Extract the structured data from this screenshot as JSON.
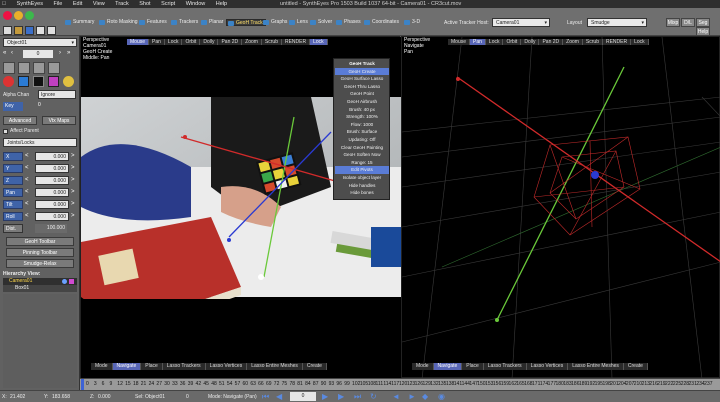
{
  "menubar": {
    "app": "SynthEyes",
    "items": [
      "File",
      "Edit",
      "View",
      "Track",
      "Shot",
      "Script",
      "Window",
      "Help"
    ],
    "title": "untitled - SynthEyes Pro 1503 Build 1037 64-bit - Camera01 - CR3cut.mov"
  },
  "toolbar": {
    "summary": "Summary",
    "roto": "Roto Masking",
    "features": "Features",
    "trackers": "Trackers",
    "planar": "Planar",
    "geotrack": "GeoH Track",
    "graphs": "Graphs",
    "lens": "Lens",
    "solver": "Solver",
    "phases": "Phases",
    "coordinates": "Coordinates",
    "threed": "3-D",
    "active_host_label": "Active Tracker Host:",
    "active_host_value": "Camera01",
    "layout_label": "Layout",
    "layout_value": "Smudge",
    "mixed_buttons": [
      "Mixp",
      "D/L",
      "Seg",
      "Help"
    ]
  },
  "leftpanel": {
    "object_select": "Object01",
    "frame_value": "0",
    "alpha_label": "Alpha Chan",
    "alpha_value": "Ignore",
    "key_label": "Key",
    "key_value": "0",
    "advanced": "Advanced",
    "vtx_maps": "Vtx Maps",
    "affect_parent": "Affect Parent",
    "joints_select": "Joints/Locks",
    "axes": [
      {
        "key": "X",
        "val": "0.000"
      },
      {
        "key": "Y",
        "val": "0.000"
      },
      {
        "key": "Z",
        "val": "0.000"
      },
      {
        "key": "Pan",
        "val": "0.000"
      },
      {
        "key": "Tilt",
        "val": "0.000"
      },
      {
        "key": "Roll",
        "val": "0.000"
      }
    ],
    "dist_label": "Dist.",
    "dist_value": "100.000",
    "geoh_toolbar": "GeoH Toolbar",
    "pinning_toolbar": "Pinning Toolbar",
    "smudge_relax": "Smudge-Relax",
    "hierarchy_label": "Hierarchy View:",
    "tree": [
      "Camera01",
      "Box01"
    ]
  },
  "viewport_left": {
    "labels": [
      "Perspective",
      "Camera01",
      "GeoH Create",
      "Middle: Pan"
    ],
    "tabs": [
      "Mouse",
      "Pan",
      "Lock",
      "Orbit",
      "Dolly",
      "Pan 2D",
      "Zoom",
      "Scrub",
      "RENDER",
      "Lock"
    ],
    "active_tab": 9,
    "bottom": [
      "Mode",
      "Navigate",
      "Place",
      "Lasso Trackers",
      "Lasso Vertices",
      "Lasso Entire Meshes",
      "Create"
    ],
    "bottom_active": 1
  },
  "viewport_right": {
    "labels": [
      "Perspective",
      "Navigate",
      "Pan"
    ],
    "tabs": [
      "Mouse",
      "Pan",
      "Lock",
      "Orbit",
      "Dolly",
      "Pan 2D",
      "Zoom",
      "Scrub",
      "RENDER",
      "Lock"
    ],
    "active_tab": 1,
    "bottom": [
      "Mode",
      "Navigate",
      "Place",
      "Lasso Trackers",
      "Lasso Vertices",
      "Lasso Entire Meshes",
      "Create"
    ],
    "bottom_active": 1
  },
  "geomenu": {
    "items": [
      "GeoH Track",
      "GeoH Create",
      "GeoH Surface Lasso",
      "GeoH Thru Lasso",
      "GeoH Point",
      "GeoH Airbrush",
      "Brush: 40 px",
      "Strength: 100%",
      "Flow: 1000",
      "Brush: Surface",
      "Updating: Off",
      "Clear GeoH Painting",
      "GeoH Soften Now",
      "Range:    15",
      "Edit Pivots",
      "Isolate object layer",
      "Hide handles",
      "Hide bones"
    ],
    "highlight": [
      1,
      14
    ]
  },
  "timeline": {
    "ticks": [
      "0",
      "3",
      "6",
      "9",
      "12",
      "15",
      "18",
      "21",
      "24",
      "27",
      "30",
      "33",
      "36",
      "39",
      "42",
      "45",
      "48",
      "51",
      "54",
      "57",
      "60",
      "63",
      "66",
      "69",
      "72",
      "75",
      "78",
      "81",
      "84",
      "87",
      "90",
      "93",
      "96",
      "99",
      "102",
      "105",
      "108",
      "111",
      "114",
      "117",
      "120",
      "123",
      "126",
      "129",
      "132",
      "135",
      "138",
      "141",
      "144",
      "147",
      "150",
      "153",
      "156",
      "159",
      "162",
      "165",
      "168",
      "171",
      "174",
      "177",
      "180",
      "183",
      "186",
      "189",
      "192",
      "195",
      "198",
      "201",
      "204",
      "207",
      "210",
      "213",
      "216",
      "219",
      "222",
      "225",
      "228",
      "231",
      "234",
      "237"
    ]
  },
  "status": {
    "x_label": "X:",
    "x_val": "21.402",
    "y_label": "Y:",
    "y_val": "183.658",
    "z_label": "Z:",
    "z_val": "0.000",
    "sel": "Sel: Object01",
    "frame": "0",
    "mode": "Mode: Navigate (Pan)"
  }
}
